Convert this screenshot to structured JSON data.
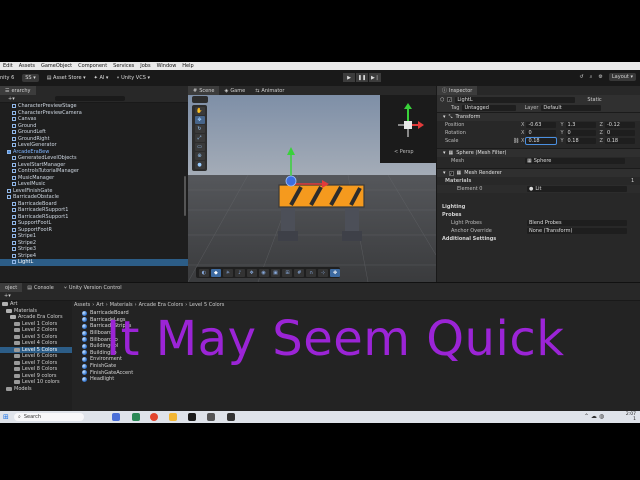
{
  "menu": [
    "Edit",
    "Assets",
    "GameObject",
    "Component",
    "Services",
    "Jobs",
    "Window",
    "Help"
  ],
  "toolbar": {
    "unity_label": "nity 6",
    "account": "SS",
    "asset_store": "Asset Store",
    "ai": "AI",
    "vcs": "Unity VCS",
    "layout": "Layout"
  },
  "hierarchy": {
    "tab": "erarchy",
    "items": [
      {
        "label": "CharacterPreviewStage",
        "indent": 2,
        "style": "normal"
      },
      {
        "label": "CharacterPreviewCamera",
        "indent": 2,
        "style": "normal"
      },
      {
        "label": "Canvas",
        "indent": 2,
        "style": "normal"
      },
      {
        "label": "Ground",
        "indent": 2,
        "style": "normal"
      },
      {
        "label": "GroundLeft",
        "indent": 2,
        "style": "normal"
      },
      {
        "label": "GroundRight",
        "indent": 2,
        "style": "normal"
      },
      {
        "label": "LevelGenerator",
        "indent": 2,
        "style": "normal"
      },
      {
        "label": "ArcadeEraBew",
        "indent": 1,
        "style": "prefab"
      },
      {
        "label": "GeneratedLevelObjects",
        "indent": 2,
        "style": "normal"
      },
      {
        "label": "LevelStartManager",
        "indent": 2,
        "style": "normal"
      },
      {
        "label": "ControlsTutorialManager",
        "indent": 2,
        "style": "normal"
      },
      {
        "label": "MusicManager",
        "indent": 2,
        "style": "normal"
      },
      {
        "label": "LevelMusic",
        "indent": 2,
        "style": "normal"
      },
      {
        "label": "LevelFinishGate",
        "indent": 1,
        "style": "normal"
      },
      {
        "label": "BarricadeObstacle",
        "indent": 1,
        "style": "normal"
      },
      {
        "label": "BarricadeBoard",
        "indent": 2,
        "style": "normal"
      },
      {
        "label": "BarricadeRSupport1",
        "indent": 2,
        "style": "normal"
      },
      {
        "label": "BarricadeRSupport1",
        "indent": 2,
        "style": "normal"
      },
      {
        "label": "SupportFootL",
        "indent": 2,
        "style": "normal"
      },
      {
        "label": "SupportFootR",
        "indent": 2,
        "style": "normal"
      },
      {
        "label": "Stripe1",
        "indent": 2,
        "style": "normal"
      },
      {
        "label": "Stripe2",
        "indent": 2,
        "style": "normal"
      },
      {
        "label": "Stripe3",
        "indent": 2,
        "style": "normal"
      },
      {
        "label": "Stripe4",
        "indent": 2,
        "style": "normal"
      },
      {
        "label": "LightL",
        "indent": 2,
        "style": "selected"
      }
    ]
  },
  "scene": {
    "tabs": [
      {
        "label": "Scene",
        "icon": "grid-icon"
      },
      {
        "label": "Game",
        "icon": "gamepad-icon"
      },
      {
        "label": "Animator",
        "icon": "animator-icon"
      }
    ],
    "persp_label": "< Persp"
  },
  "inspector": {
    "tab": "Inspector",
    "static_label": "Static",
    "object_name": "LightL",
    "tag_label": "Tag",
    "tag_value": "Untagged",
    "layer_label": "Layer",
    "layer_value": "Default",
    "transform_title": "Transform",
    "position_label": "Position",
    "rotation_label": "Rotation",
    "scale_label": "Scale",
    "position": {
      "x": "-0.63",
      "y": "1.3",
      "z": "-0.12"
    },
    "rotation": {
      "x": "0",
      "y": "0",
      "z": "0"
    },
    "scale": {
      "x": "0.18",
      "y": "0.18",
      "z": "0.18"
    },
    "mesh_filter_title": "Sphere (Mesh Filter)",
    "mesh_label": "Mesh",
    "mesh_value": "Sphere",
    "mesh_renderer_title": "Mesh Renderer",
    "materials_label": "Materials",
    "materials_count": "1",
    "element0_label": "Element 0",
    "element0_value": "Lit",
    "lighting_label": "Lighting",
    "probes_label": "Probes",
    "light_probes_label": "Light Probes",
    "light_probes_value": "Blend Probes",
    "anchor_label": "Anchor Override",
    "anchor_value": "None (Transform)",
    "additional_label": "Additional Settings"
  },
  "project": {
    "tabs": [
      "oject",
      "Console",
      "Unity Version Control"
    ],
    "breadcrumb": [
      "Assets",
      "Art",
      "Materials",
      "Arcade Era Colors",
      "Level 5 Colors"
    ],
    "tree": [
      {
        "label": "Art",
        "indent": 0,
        "open": true
      },
      {
        "label": "Materials",
        "indent": 1,
        "open": true
      },
      {
        "label": "Arcade Era Colors",
        "indent": 2,
        "open": true
      },
      {
        "label": "Level 1 Colors",
        "indent": 3,
        "open": false
      },
      {
        "label": "Level 2 Colors",
        "indent": 3,
        "open": false
      },
      {
        "label": "Level 3 Colors",
        "indent": 3,
        "open": false
      },
      {
        "label": "Level 4 Colors",
        "indent": 3,
        "open": false
      },
      {
        "label": "Level 5 Colors",
        "indent": 3,
        "open": false,
        "selected": true
      },
      {
        "label": "Level 6 Colors",
        "indent": 3,
        "open": false
      },
      {
        "label": "Level 7 Colors",
        "indent": 3,
        "open": false
      },
      {
        "label": "Level 8 Colors",
        "indent": 3,
        "open": false
      },
      {
        "label": "Level 9 colors",
        "indent": 3,
        "open": false
      },
      {
        "label": "Level 10 colors",
        "indent": 3,
        "open": false
      },
      {
        "label": "Models",
        "indent": 1,
        "open": false
      }
    ],
    "assets": [
      "BarricadeBoard",
      "BarricadeLegs",
      "BarricadeStripes",
      "Billboard",
      "BillboardFo",
      "BuildingCol",
      "BuildingRo",
      "Environment",
      "FinishGate",
      "FinishGateAccent",
      "Headlight"
    ]
  },
  "caption": "It May Seem Quick",
  "taskbar": {
    "search": "Search",
    "time": "2:07",
    "date": "1"
  },
  "colors": {
    "caption": "#9b24d6",
    "selection": "#2c5d87",
    "barricade_orange": "#f59a1e"
  }
}
